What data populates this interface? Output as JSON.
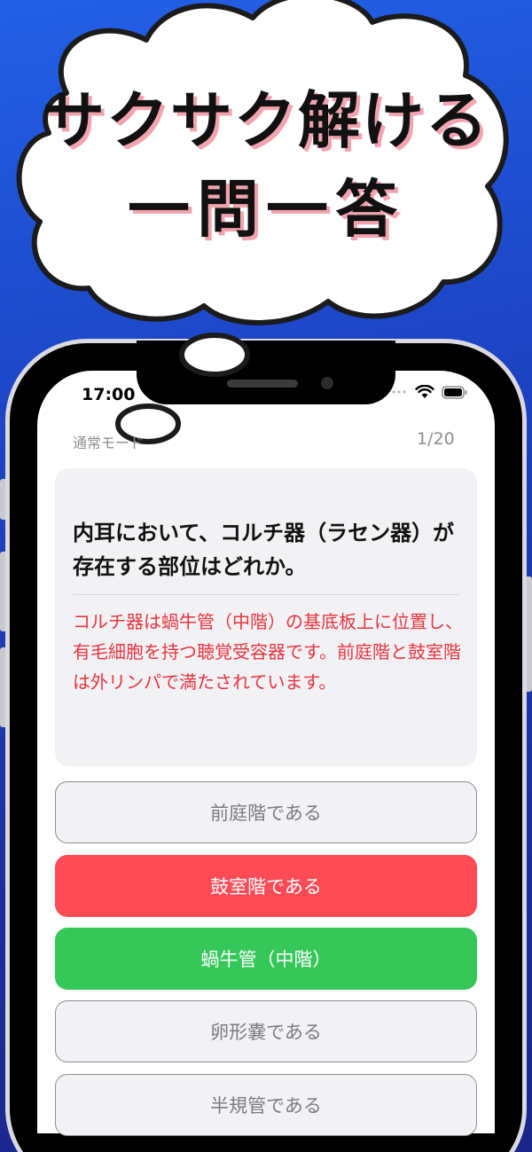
{
  "banner": {
    "line1": "サクサク解ける",
    "line2": "一問一答"
  },
  "status_bar": {
    "time": "17:00"
  },
  "header": {
    "mode": "通常モード",
    "counter": "1/20"
  },
  "question": {
    "text": "内耳において、コルチ器（ラセン器）が存在する部位はどれか。",
    "explanation": "コルチ器は蝸牛管（中階）の基底板上に位置し、有毛細胞を持つ聴覚受容器です。前庭階と鼓室階は外リンパで満たされています。"
  },
  "options": [
    {
      "label": "前庭階である",
      "state": "neutral"
    },
    {
      "label": "鼓室階である",
      "state": "wrong"
    },
    {
      "label": "蝸牛管（中階）",
      "state": "correct"
    },
    {
      "label": "卵形嚢である",
      "state": "neutral"
    },
    {
      "label": "半規管である",
      "state": "neutral"
    }
  ],
  "colors": {
    "background_top": "#2260e6",
    "background_bottom": "#1b268a",
    "explanation_text": "#e8343e",
    "wrong_option": "#ff4b55",
    "correct_option": "#36c759",
    "headline_shadow": "#f3a3ad"
  },
  "icons": [
    "wifi-icon",
    "battery-icon",
    "signal-icon"
  ]
}
